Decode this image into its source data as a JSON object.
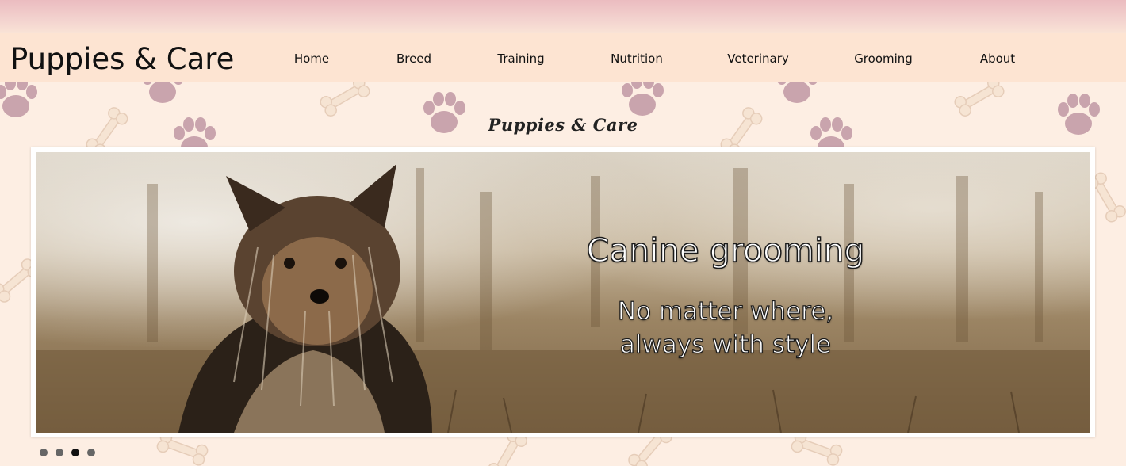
{
  "site": {
    "title": "Puppies & Care",
    "script_title": "Puppies & Care"
  },
  "nav": {
    "items": [
      {
        "label": "Home"
      },
      {
        "label": "Breed"
      },
      {
        "label": "Training"
      },
      {
        "label": "Nutrition"
      },
      {
        "label": "Veterinary"
      },
      {
        "label": "Grooming"
      },
      {
        "label": "About"
      }
    ]
  },
  "slider": {
    "heading": "Canine grooming",
    "sub_line1": "No matter where,",
    "sub_line2": "always with style",
    "slide_count": 4,
    "active_index": 2
  },
  "colors": {
    "header_bg": "#fde4d2",
    "page_bg": "#fdeee3",
    "top_band": "#ebbcc0",
    "paw": "#c9a4ad",
    "bone": "#f6e4d3"
  },
  "icons": {
    "pattern_paw": "paw-print-icon",
    "pattern_bone": "bone-icon"
  }
}
